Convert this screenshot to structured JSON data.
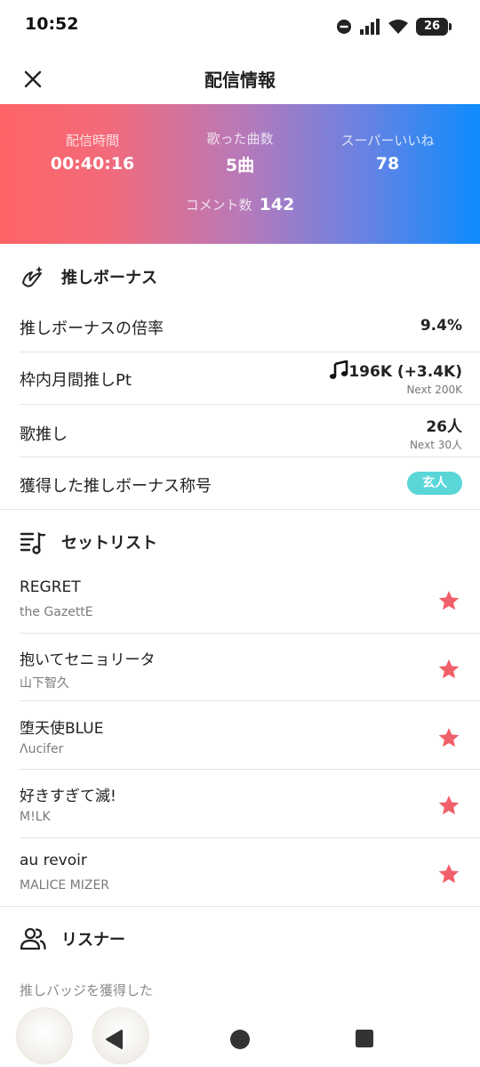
{
  "status_bar": {
    "time": "10:52",
    "battery": "26",
    "icons": [
      "dnd-icon",
      "signal-icon",
      "wifi-icon",
      "battery-icon"
    ]
  },
  "header": {
    "title": "配信情報",
    "close_icon": "close-icon"
  },
  "stats": {
    "duration_label": "配信時間",
    "duration_value": "00:40:16",
    "songs_label": "歌った曲数",
    "songs_value": "5曲",
    "superlikes_label": "スーパーいいね",
    "superlikes_value": "78",
    "comments_label": "コメント数",
    "comments_value": "142",
    "gradient_colors": [
      "#fe6466",
      "#0d8cfd"
    ]
  },
  "oshi_bonus": {
    "title": "推しボーナス",
    "icon": "wing-icon",
    "rows": [
      {
        "label": "推しボーナスの倍率",
        "value": "9.4%"
      },
      {
        "label": "枠内月間推しPt",
        "value": "196K (+3.4K)",
        "sub": "Next 200K",
        "icon": "music-note-icon"
      },
      {
        "label": "歌推し",
        "value": "26人",
        "sub": "Next 30人"
      },
      {
        "label": "獲得した推しボーナス称号",
        "badge": "玄人"
      }
    ],
    "badge_color": "#5ad6d8"
  },
  "setlist": {
    "title": "セットリスト",
    "icon": "setlist-icon",
    "star_color": "#f0606a",
    "songs": [
      {
        "title": "REGRET",
        "artist": "the GazettE"
      },
      {
        "title": "抱いてセニョリータ",
        "artist": "山下智久"
      },
      {
        "title": "堕天使BLUE",
        "artist": "Λucifer"
      },
      {
        "title": "好きすぎて滅!",
        "artist": "M!LK"
      },
      {
        "title": "au revoir",
        "artist": "MALICE MIZER"
      }
    ]
  },
  "listeners": {
    "title": "リスナー",
    "icon": "users-icon",
    "subtitle": "推しバッジを獲得した"
  },
  "nav": {
    "back": "back-icon",
    "home": "home-icon",
    "recents": "recents-icon"
  }
}
